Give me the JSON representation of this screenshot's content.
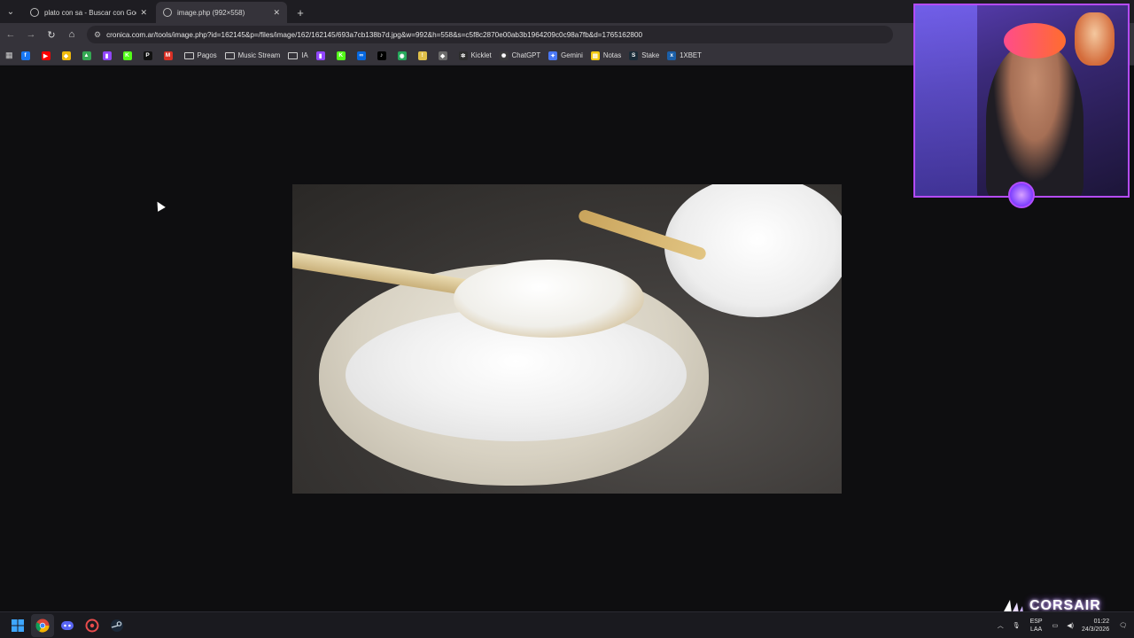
{
  "tabs": [
    {
      "title": "plato con sa - Buscar con Goog",
      "active": false
    },
    {
      "title": "image.php (992×558)",
      "active": true
    }
  ],
  "toolbar": {
    "url": "cronica.com.ar/tools/image.php?id=162145&p=/files/image/162/162145/693a7cb138b7d.jpg&w=992&h=558&s=c5f8c2870e00ab3b1964209c0c98a7fb&d=1765162800"
  },
  "bookmarks": [
    {
      "label": "",
      "icon": "facebook-icon",
      "color": "#1877f2",
      "glyph": "f"
    },
    {
      "label": "",
      "icon": "youtube-icon",
      "color": "#ff0000",
      "glyph": "▶"
    },
    {
      "label": "",
      "icon": "binance-icon",
      "color": "#f0b90b",
      "glyph": "◆"
    },
    {
      "label": "",
      "icon": "drive-icon",
      "color": "#34a853",
      "glyph": "▲"
    },
    {
      "label": "",
      "icon": "twitch-icon",
      "color": "#9146ff",
      "glyph": "▮"
    },
    {
      "label": "",
      "icon": "kick-icon",
      "color": "#53fc18",
      "glyph": "K"
    },
    {
      "label": "",
      "icon": "patreon-icon",
      "color": "#111111",
      "glyph": "P"
    },
    {
      "label": "",
      "icon": "gmail-icon",
      "color": "#d93025",
      "glyph": "M"
    },
    {
      "label": "Pagos",
      "icon": "folder-icon",
      "folder": true
    },
    {
      "label": "Music Stream",
      "icon": "folder-icon",
      "folder": true
    },
    {
      "label": "IA",
      "icon": "folder-icon",
      "folder": true
    },
    {
      "label": "",
      "icon": "twitch-icon",
      "color": "#9146ff",
      "glyph": "▮"
    },
    {
      "label": "",
      "icon": "kick-icon",
      "color": "#53fc18",
      "glyph": "K"
    },
    {
      "label": "",
      "icon": "meta-icon",
      "color": "#0668e1",
      "glyph": "∞"
    },
    {
      "label": "",
      "icon": "tiktok-icon",
      "color": "#000000",
      "glyph": "♪"
    },
    {
      "label": "",
      "icon": "app-icon",
      "color": "#25a85b",
      "glyph": "◉"
    },
    {
      "label": "",
      "icon": "lamp-icon",
      "color": "#e0c04a",
      "glyph": "!"
    },
    {
      "label": "",
      "icon": "diamond-icon",
      "color": "#6b6b6b",
      "glyph": "◆"
    },
    {
      "label": "Kicklet",
      "icon": "kicklet-icon",
      "color": "#2d2d2d",
      "glyph": "✲"
    },
    {
      "label": "ChatGPT",
      "icon": "chatgpt-icon",
      "color": "#3a3a3a",
      "glyph": "✺"
    },
    {
      "label": "Gemini",
      "icon": "gemini-icon",
      "color": "#4a78f5",
      "glyph": "✦"
    },
    {
      "label": "Notas",
      "icon": "notes-icon",
      "color": "#f2c811",
      "glyph": "▤"
    },
    {
      "label": "Stake",
      "icon": "stake-icon",
      "color": "#1a2c38",
      "glyph": "S"
    },
    {
      "label": "1XBET",
      "icon": "1xbet-icon",
      "color": "#1b5fa8",
      "glyph": "x"
    }
  ],
  "branding": {
    "corsair": "CORSAIR"
  },
  "taskbar": {
    "apps": [
      {
        "icon": "windows-start-icon"
      },
      {
        "icon": "chrome-icon",
        "active": true
      },
      {
        "icon": "discord-icon"
      },
      {
        "icon": "browser-icon"
      },
      {
        "icon": "steam-icon"
      }
    ],
    "tray": {
      "lang_line1": "ESP",
      "lang_line2": "LAA",
      "time": "01:22",
      "date": "24/3/2026"
    }
  }
}
